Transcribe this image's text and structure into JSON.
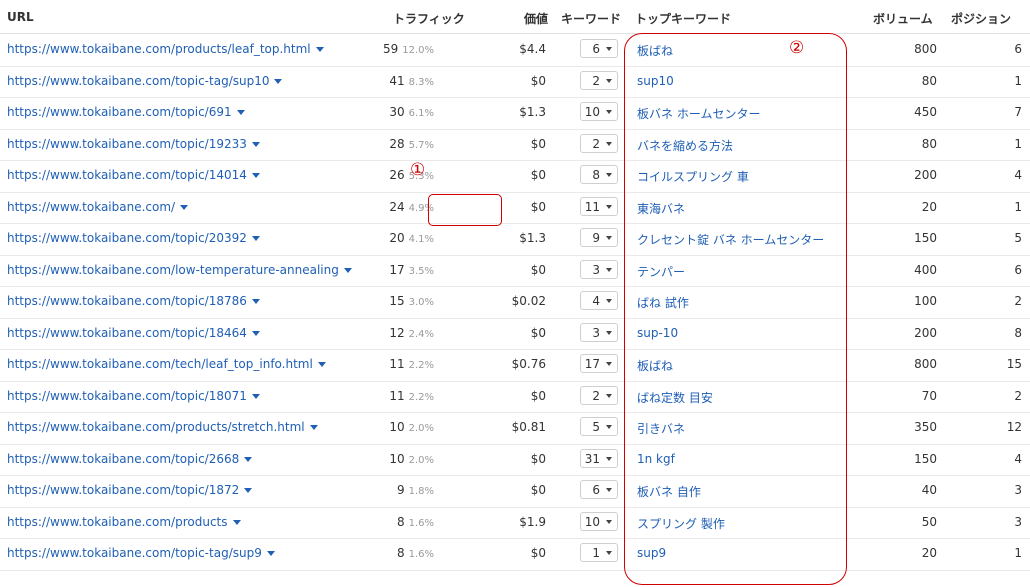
{
  "headers": {
    "url": "URL",
    "traffic": "トラフィック",
    "value": "価値",
    "keywords": "キーワード",
    "top_keyword": "トップキーワード",
    "volume": "ボリューム",
    "position": "ポジション"
  },
  "annotations": {
    "one": "①",
    "two": "②"
  },
  "colors": {
    "link": "#1f5fb5",
    "annotation": "#d00000"
  },
  "rows": [
    {
      "url": "https://www.tokaibane.com/products/leaf_top.html",
      "traffic": "59",
      "pct": "12.0%",
      "value": "$4.4",
      "kw": "6",
      "top": "板ばね",
      "vol": "800",
      "pos": "6"
    },
    {
      "url": "https://www.tokaibane.com/topic-tag/sup10",
      "traffic": "41",
      "pct": "8.3%",
      "value": "$0",
      "kw": "2",
      "top": "sup10",
      "vol": "80",
      "pos": "1"
    },
    {
      "url": "https://www.tokaibane.com/topic/691",
      "traffic": "30",
      "pct": "6.1%",
      "value": "$1.3",
      "kw": "10",
      "top": "板バネ ホームセンター",
      "vol": "450",
      "pos": "7"
    },
    {
      "url": "https://www.tokaibane.com/topic/19233",
      "traffic": "28",
      "pct": "5.7%",
      "value": "$0",
      "kw": "2",
      "top": "バネを縮める方法",
      "vol": "80",
      "pos": "1"
    },
    {
      "url": "https://www.tokaibane.com/topic/14014",
      "traffic": "26",
      "pct": "5.3%",
      "value": "$0",
      "kw": "8",
      "top": "コイルスプリング 車",
      "vol": "200",
      "pos": "4"
    },
    {
      "url": "https://www.tokaibane.com/",
      "traffic": "24",
      "pct": "4.9%",
      "value": "$0",
      "kw": "11",
      "top": "東海バネ",
      "vol": "20",
      "pos": "1"
    },
    {
      "url": "https://www.tokaibane.com/topic/20392",
      "traffic": "20",
      "pct": "4.1%",
      "value": "$1.3",
      "kw": "9",
      "top": "クレセント錠 バネ ホームセンター",
      "vol": "150",
      "pos": "5"
    },
    {
      "url": "https://www.tokaibane.com/low-temperature-annealing",
      "traffic": "17",
      "pct": "3.5%",
      "value": "$0",
      "kw": "3",
      "top": "テンパー",
      "vol": "400",
      "pos": "6"
    },
    {
      "url": "https://www.tokaibane.com/topic/18786",
      "traffic": "15",
      "pct": "3.0%",
      "value": "$0.02",
      "kw": "4",
      "top": "ばね 試作",
      "vol": "100",
      "pos": "2"
    },
    {
      "url": "https://www.tokaibane.com/topic/18464",
      "traffic": "12",
      "pct": "2.4%",
      "value": "$0",
      "kw": "3",
      "top": "sup-10",
      "vol": "200",
      "pos": "8"
    },
    {
      "url": "https://www.tokaibane.com/tech/leaf_top_info.html",
      "traffic": "11",
      "pct": "2.2%",
      "value": "$0.76",
      "kw": "17",
      "top": "板ばね",
      "vol": "800",
      "pos": "15"
    },
    {
      "url": "https://www.tokaibane.com/topic/18071",
      "traffic": "11",
      "pct": "2.2%",
      "value": "$0",
      "kw": "2",
      "top": "ばね定数 目安",
      "vol": "70",
      "pos": "2"
    },
    {
      "url": "https://www.tokaibane.com/products/stretch.html",
      "traffic": "10",
      "pct": "2.0%",
      "value": "$0.81",
      "kw": "5",
      "top": "引きバネ",
      "vol": "350",
      "pos": "12"
    },
    {
      "url": "https://www.tokaibane.com/topic/2668",
      "traffic": "10",
      "pct": "2.0%",
      "value": "$0",
      "kw": "31",
      "top": "1n kgf",
      "vol": "150",
      "pos": "4"
    },
    {
      "url": "https://www.tokaibane.com/topic/1872",
      "traffic": "9",
      "pct": "1.8%",
      "value": "$0",
      "kw": "6",
      "top": "板バネ 自作",
      "vol": "40",
      "pos": "3"
    },
    {
      "url": "https://www.tokaibane.com/products",
      "traffic": "8",
      "pct": "1.6%",
      "value": "$1.9",
      "kw": "10",
      "top": "スプリング 製作",
      "vol": "50",
      "pos": "3"
    },
    {
      "url": "https://www.tokaibane.com/topic-tag/sup9",
      "traffic": "8",
      "pct": "1.6%",
      "value": "$0",
      "kw": "1",
      "top": "sup9",
      "vol": "20",
      "pos": "1"
    }
  ]
}
